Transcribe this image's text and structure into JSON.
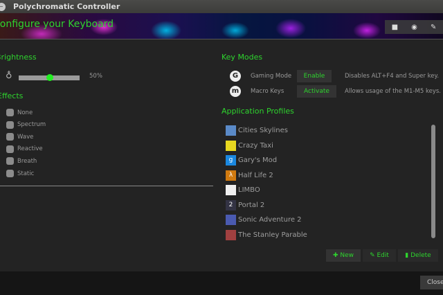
{
  "window": {
    "title": "Polychromatic Controller"
  },
  "banner": {
    "heading": "Configure your Keyboard",
    "buttons": [
      "folder-icon",
      "github-icon",
      "wrench-icon"
    ]
  },
  "brightness": {
    "heading": "Brightness",
    "value_label": "50%",
    "value": 50
  },
  "effects": {
    "heading": "Effects",
    "items": [
      "None",
      "Spectrum",
      "Wave",
      "Reactive",
      "Breath",
      "Static"
    ]
  },
  "key_modes": {
    "heading": "Key Modes",
    "modes": [
      {
        "icon": "G",
        "name": "Gaming Mode",
        "button": "Enable",
        "description": "Disables ALT+F4 and Super key."
      },
      {
        "icon": "m",
        "name": "Macro Keys",
        "button": "Activate",
        "description": "Allows usage of the M1-M5 keys."
      }
    ]
  },
  "profiles": {
    "heading": "Application Profiles",
    "items": [
      {
        "name": "Cities Skylines",
        "color": "#5a8ac8"
      },
      {
        "name": "Crazy Taxi",
        "color": "#e8d820"
      },
      {
        "name": "Gary's Mod",
        "color": "#1a88e0",
        "glyph": "g"
      },
      {
        "name": "Half Life 2",
        "color": "#d07a10",
        "glyph": "λ"
      },
      {
        "name": "LIMBO",
        "color": "#f0f0f0"
      },
      {
        "name": "Portal 2",
        "color": "#334",
        "glyph": "2"
      },
      {
        "name": "Sonic Adventure 2",
        "color": "#4a5ab0"
      },
      {
        "name": "The Stanley Parable",
        "color": "#a04040"
      }
    ],
    "actions": {
      "new": "New",
      "edit": "Edit",
      "delete": "Delete"
    }
  },
  "footer": {
    "close": "Close"
  }
}
